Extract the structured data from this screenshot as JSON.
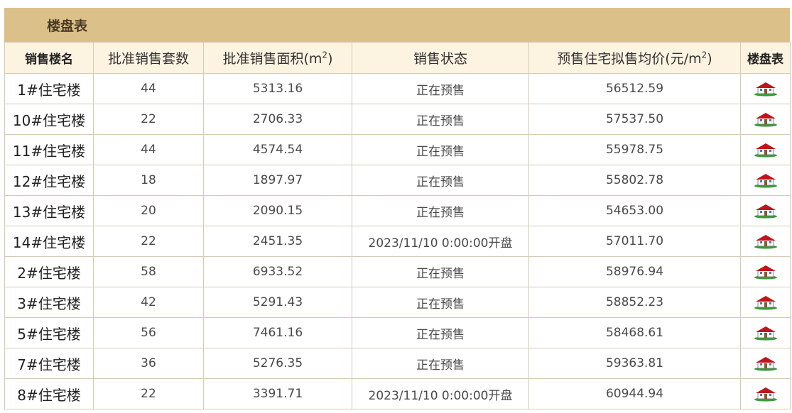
{
  "panel": {
    "title": "楼盘表"
  },
  "table": {
    "headers": {
      "building": "销售楼名",
      "units": "批准销售套数",
      "area_prefix": "批准销售面积(m",
      "area_sup": "2",
      "area_suffix": ")",
      "status": "销售状态",
      "price_prefix": "预售住宅拟售均价(元/m",
      "price_sup": "2",
      "price_suffix": ")",
      "floorplan": "楼盘表"
    },
    "rows": [
      {
        "building": "1#住宅楼",
        "units": "44",
        "area": "5313.16",
        "status": "正在预售",
        "price": "56512.59"
      },
      {
        "building": "10#住宅楼",
        "units": "22",
        "area": "2706.33",
        "status": "正在预售",
        "price": "57537.50"
      },
      {
        "building": "11#住宅楼",
        "units": "44",
        "area": "4574.54",
        "status": "正在预售",
        "price": "55978.75"
      },
      {
        "building": "12#住宅楼",
        "units": "18",
        "area": "1897.97",
        "status": "正在预售",
        "price": "55802.78"
      },
      {
        "building": "13#住宅楼",
        "units": "20",
        "area": "2090.15",
        "status": "正在预售",
        "price": "54653.00"
      },
      {
        "building": "14#住宅楼",
        "units": "22",
        "area": "2451.35",
        "status": "2023/11/10 0:00:00开盘",
        "price": "57011.70"
      },
      {
        "building": "2#住宅楼",
        "units": "58",
        "area": "6933.52",
        "status": "正在预售",
        "price": "58976.94"
      },
      {
        "building": "3#住宅楼",
        "units": "42",
        "area": "5291.43",
        "status": "正在预售",
        "price": "58852.23"
      },
      {
        "building": "5#住宅楼",
        "units": "56",
        "area": "7461.16",
        "status": "正在预售",
        "price": "58468.61"
      },
      {
        "building": "7#住宅楼",
        "units": "36",
        "area": "5276.35",
        "status": "正在预售",
        "price": "59363.81"
      },
      {
        "building": "8#住宅楼",
        "units": "22",
        "area": "3391.71",
        "status": "2023/11/10 0:00:00开盘",
        "price": "60944.94"
      }
    ]
  },
  "icons": {
    "floorplan": "house-icon"
  },
  "colors": {
    "title_bg": "#dcc08a",
    "header_bg": "#fdf3e1",
    "border": "#d5cbb7",
    "roof": "#c0141c",
    "lawn": "#3a9a3a"
  }
}
